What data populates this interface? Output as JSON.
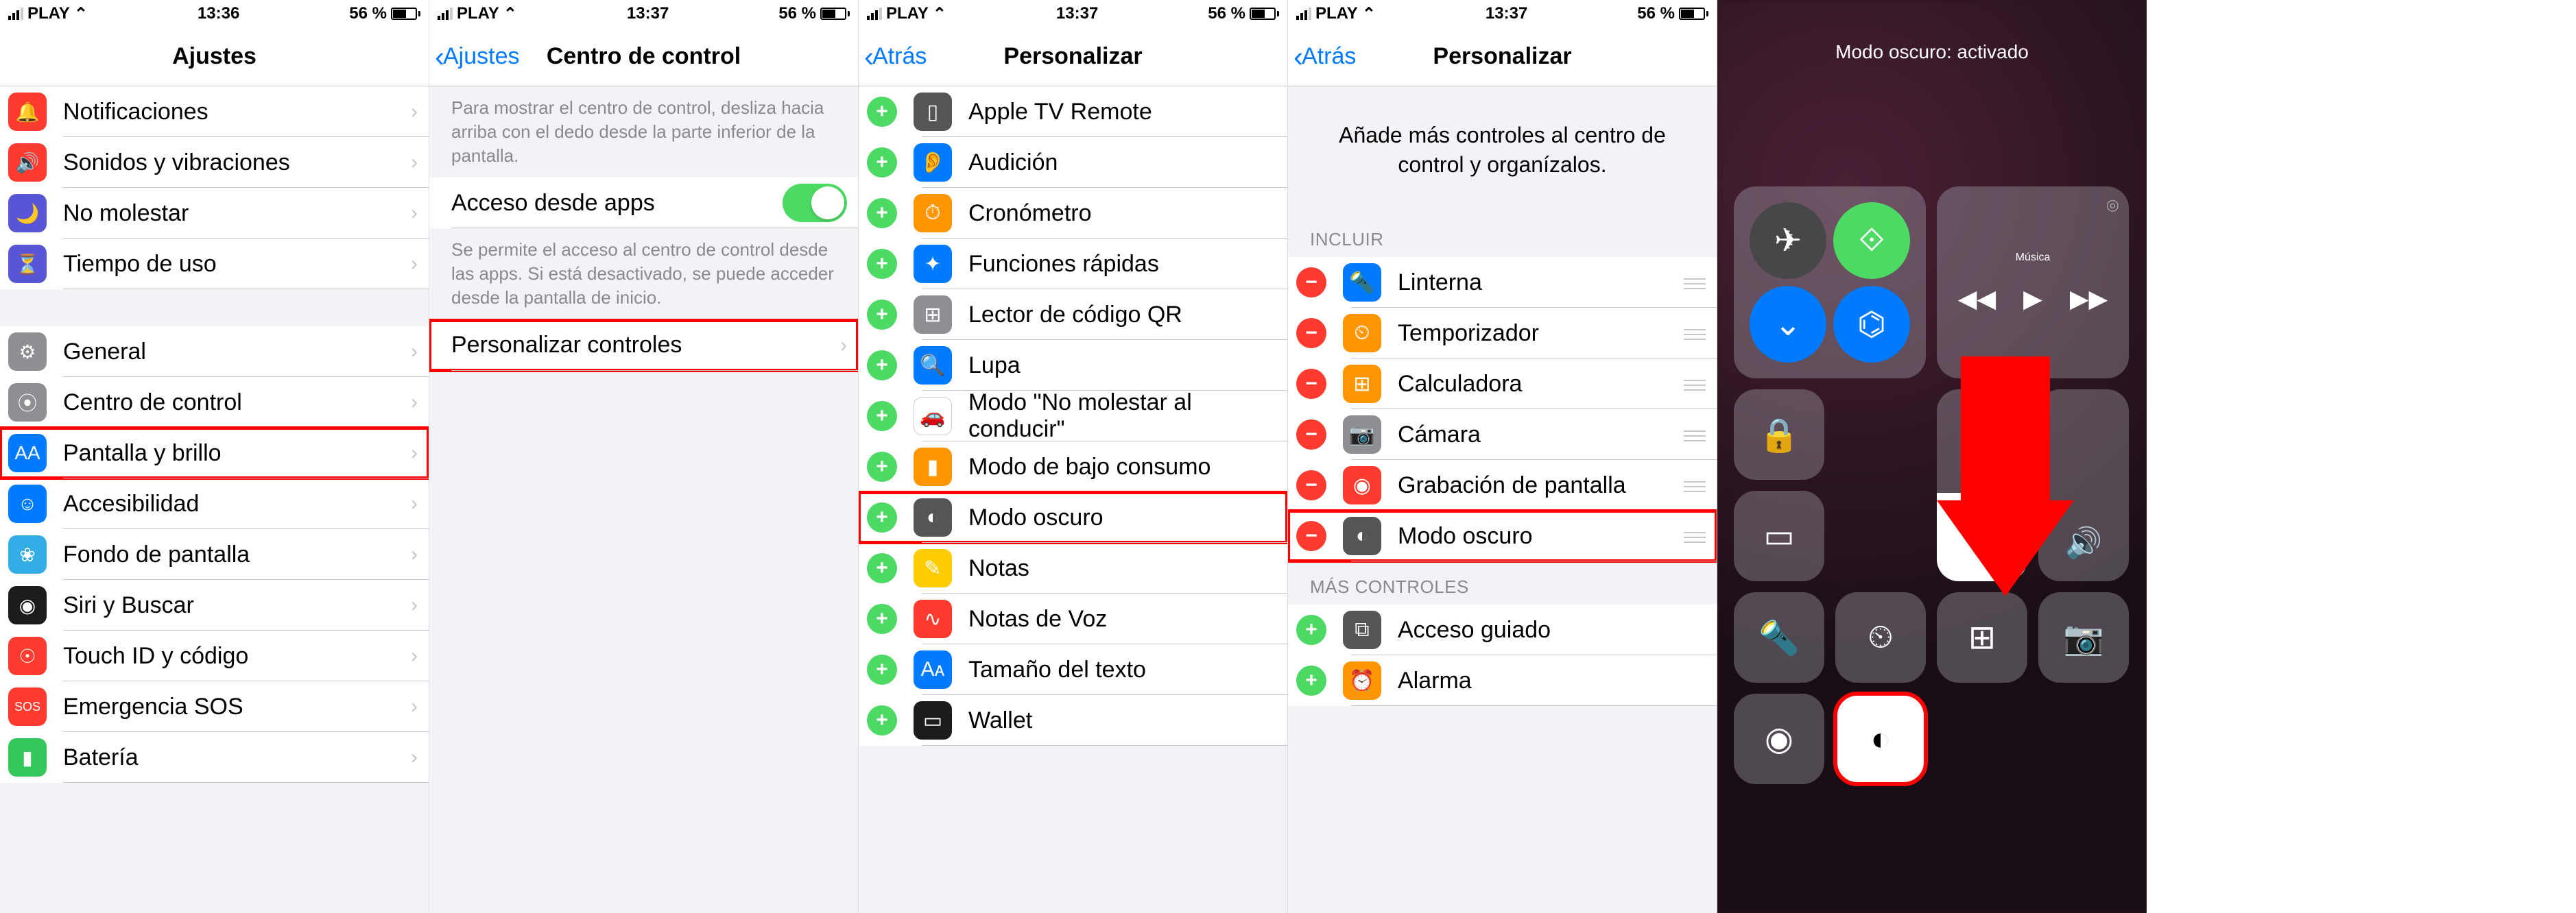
{
  "status": {
    "carrier": "PLAY",
    "time1": "13:36",
    "time2": "13:37",
    "battery_pct": "56 %"
  },
  "screen1": {
    "title": "Ajustes",
    "items_a": [
      {
        "label": "Notificaciones",
        "icon": "🔔",
        "bg": "ic-red"
      },
      {
        "label": "Sonidos y vibraciones",
        "icon": "🔊",
        "bg": "ic-red"
      },
      {
        "label": "No molestar",
        "icon": "🌙",
        "bg": "ic-purple"
      },
      {
        "label": "Tiempo de uso",
        "icon": "⏳",
        "bg": "ic-purple"
      }
    ],
    "items_b": [
      {
        "label": "General",
        "icon": "⚙︎",
        "bg": "ic-gray"
      },
      {
        "label": "Centro de control",
        "icon": "⦿",
        "bg": "ic-gray"
      },
      {
        "label": "Pantalla y brillo",
        "icon": "AA",
        "bg": "ic-blue",
        "hl": true
      },
      {
        "label": "Accesibilidad",
        "icon": "☺",
        "bg": "ic-blue"
      },
      {
        "label": "Fondo de pantalla",
        "icon": "❀",
        "bg": "ic-cyan"
      },
      {
        "label": "Siri y Buscar",
        "icon": "◉",
        "bg": "ic-black"
      },
      {
        "label": "Touch ID y código",
        "icon": "☉",
        "bg": "ic-red"
      },
      {
        "label": "Emergencia SOS",
        "icon": "SOS",
        "bg": "ic-red"
      },
      {
        "label": "Batería",
        "icon": "▮",
        "bg": "ic-green"
      }
    ]
  },
  "screen2": {
    "back": "Ajustes",
    "title": "Centro de control",
    "desc1": "Para mostrar el centro de control, desliza hacia arriba con el dedo desde la parte inferior de la pantalla.",
    "toggle_label": "Acceso desde apps",
    "desc2": "Se permite el acceso al centro de control desde las apps. Si está desactivado, se puede acceder desde la pantalla de inicio.",
    "customize": "Personalizar controles"
  },
  "screen3": {
    "back": "Atrás",
    "title": "Personalizar",
    "items": [
      {
        "label": "Apple TV Remote",
        "icon": "▯",
        "bg": "ic-darkgray"
      },
      {
        "label": "Audición",
        "icon": "👂",
        "bg": "ic-blue"
      },
      {
        "label": "Cronómetro",
        "icon": "⏱",
        "bg": "ic-orange"
      },
      {
        "label": "Funciones rápidas",
        "icon": "✦",
        "bg": "ic-blue"
      },
      {
        "label": "Lector de código QR",
        "icon": "⊞",
        "bg": "ic-gray"
      },
      {
        "label": "Lupa",
        "icon": "🔍",
        "bg": "ic-blue"
      },
      {
        "label": "Modo \"No molestar al conducir\"",
        "icon": "🚗",
        "bg": "ic-white"
      },
      {
        "label": "Modo de bajo consumo",
        "icon": "▮",
        "bg": "ic-orange"
      },
      {
        "label": "Modo oscuro",
        "icon": "◐",
        "bg": "ic-darkgray",
        "hl": true
      },
      {
        "label": "Notas",
        "icon": "✎",
        "bg": "ic-yellow"
      },
      {
        "label": "Notas de Voz",
        "icon": "∿",
        "bg": "ic-red"
      },
      {
        "label": "Tamaño del texto",
        "icon": "Aᴀ",
        "bg": "ic-blue"
      },
      {
        "label": "Wallet",
        "icon": "▭",
        "bg": "ic-black"
      }
    ]
  },
  "screen4": {
    "back": "Atrás",
    "title": "Personalizar",
    "intro": "Añade más controles al centro de control y organízalos.",
    "include_header": "INCLUIR",
    "more_header": "MÁS CONTROLES",
    "included": [
      {
        "label": "Linterna",
        "icon": "🔦",
        "bg": "ic-blue"
      },
      {
        "label": "Temporizador",
        "icon": "⏲",
        "bg": "ic-orange"
      },
      {
        "label": "Calculadora",
        "icon": "⊞",
        "bg": "ic-orange"
      },
      {
        "label": "Cámara",
        "icon": "📷",
        "bg": "ic-gray"
      },
      {
        "label": "Grabación de pantalla",
        "icon": "◉",
        "bg": "ic-red"
      },
      {
        "label": "Modo oscuro",
        "icon": "◐",
        "bg": "ic-darkgray",
        "hl": true
      }
    ],
    "more": [
      {
        "label": "Acceso guiado",
        "icon": "⧉",
        "bg": "ic-darkgray"
      },
      {
        "label": "Alarma",
        "icon": "⏰",
        "bg": "ic-orange"
      }
    ]
  },
  "screen5": {
    "banner": "Modo oscuro: activado",
    "media_title": "Música",
    "conn_colors": {
      "airplane": "#474749",
      "cellular": "#4cd964",
      "wifi": "#007aff",
      "bluetooth": "#007aff"
    }
  }
}
